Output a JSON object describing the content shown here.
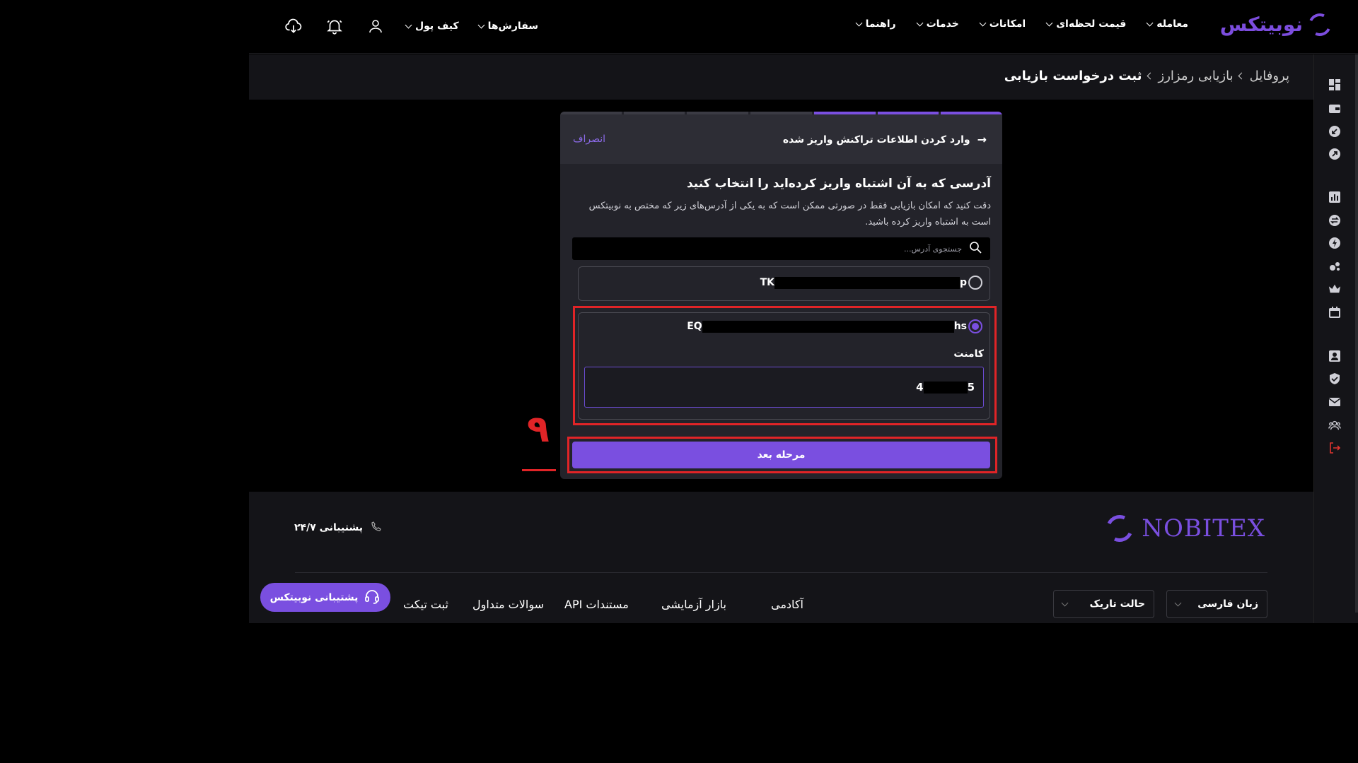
{
  "header": {
    "brand": "نوبیتکس",
    "nav": [
      {
        "label": "معامله"
      },
      {
        "label": "قیمت لحظه‌ای"
      },
      {
        "label": "امکانات"
      },
      {
        "label": "خدمات"
      },
      {
        "label": "راهنما"
      }
    ],
    "wallet_label": "کیف پول",
    "orders_label": "سفارش‌ها"
  },
  "breadcrumb": {
    "items": [
      "پروفایل",
      "بازیابی رمزارز"
    ],
    "current": "ثبت درخواست بازیابی"
  },
  "card": {
    "progress": {
      "steps_total": 7,
      "steps_done": 3
    },
    "header_title": "وارد کردن اطلاعات تراکنش واریز شده",
    "cancel": "انصراف",
    "question": "آدرسی که به آن اشتباه واریز کرده‌اید را انتخاب کنید",
    "description": "دقت کنید که امکان بازیابی فقط در صورتی ممکن است که به یکی از آدرس‌های زیر که مختص به نوبیتکس است به اشتباه واریز کرده باشید.",
    "search_placeholder": "جستجوی آدرس...",
    "addresses": [
      {
        "prefix": "TK",
        "suffix": "p",
        "selected": false
      },
      {
        "prefix": "EQ",
        "suffix": "hs",
        "selected": true
      }
    ],
    "comment_label": "کامنت",
    "comment_prefix": "4",
    "comment_suffix": "5",
    "next_button": "مرحله بعد"
  },
  "annotation": {
    "number": "۹"
  },
  "footer": {
    "logo": "NOBITEX",
    "support_phone": "پشتیبانی ۲۴/۷",
    "links": [
      "آکادمی",
      "بازار آزمایشی",
      "مستندات API",
      "سوالات متداول",
      "ثبت تیکت"
    ],
    "language": "زبان فارسی",
    "theme": "حالت تاریک",
    "support_button": "پشتیبانی نوبیتکس"
  },
  "colors": {
    "accent": "#7a4fe0",
    "highlight": "#e02427",
    "background": "#000000",
    "panel": "#23232a"
  }
}
